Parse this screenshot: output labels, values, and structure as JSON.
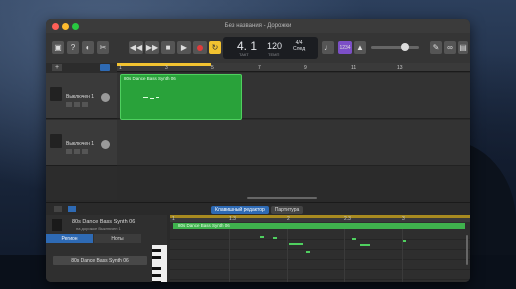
{
  "window": {
    "title": "Без названия - Дорожки"
  },
  "toolbar": {
    "lcd": {
      "position": "4. 1",
      "bpm": "120",
      "sig_top": "4/4",
      "sig_bottom": "Cлед",
      "beat_label": "ТАКТ",
      "tempo_label": "ТЕМП"
    },
    "count_in": "1234"
  },
  "tracks": [
    {
      "name": "Выключен 1"
    },
    {
      "name": "Выключен 1"
    }
  ],
  "ruler": [
    "1",
    "3",
    "5",
    "7",
    "9",
    "11",
    "13"
  ],
  "region": {
    "name": "80s Dance Bass Synth 06"
  },
  "editor": {
    "tabs": [
      "Клавишный редактор",
      "Партитура"
    ],
    "instrument_name": "80s Dance Bass Synth 06",
    "instrument_sub": "на дорожке Выключен 1",
    "segments": [
      "Регион",
      "Ноты"
    ],
    "region_slot": "80s Dance Bass Synth 06",
    "roll_ruler": [
      "1",
      "1.3",
      "2",
      "2.3",
      "3"
    ],
    "roll_region": "80s Dance Bass Synth 06"
  },
  "colors": {
    "region_green": "#29a23a",
    "accent_blue": "#2e6ab4",
    "record_red": "#e23b3b",
    "metronome_yellow": "#f2c230"
  }
}
